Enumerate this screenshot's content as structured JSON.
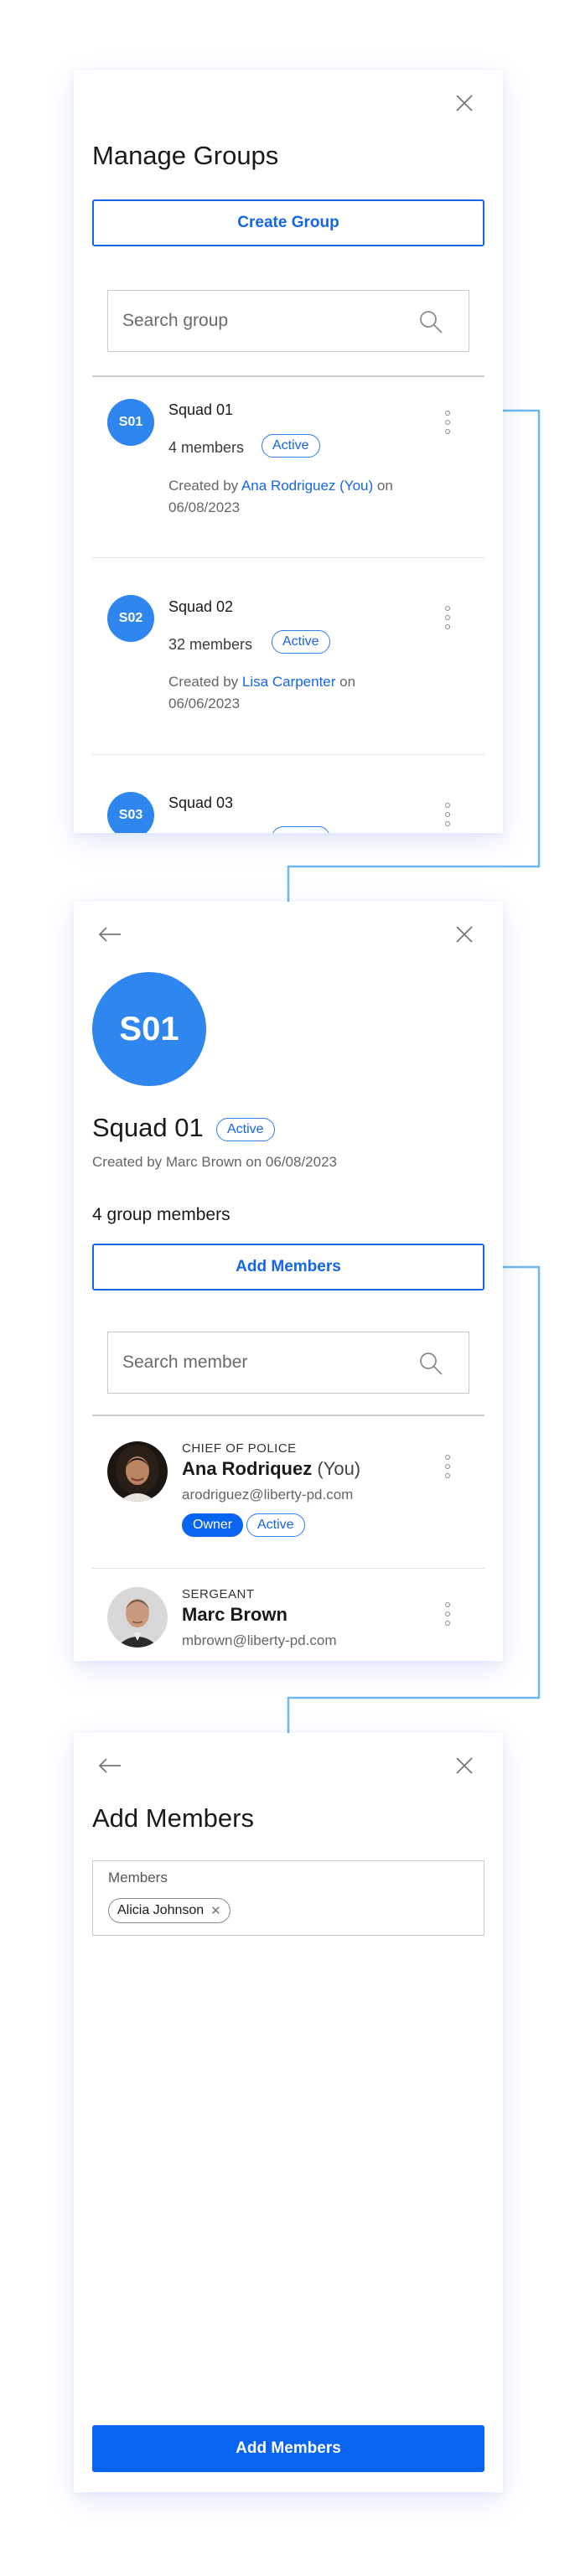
{
  "manage_groups": {
    "title": "Manage Groups",
    "create_button": "Create Group",
    "search_placeholder": "Search group",
    "groups": [
      {
        "initials": "S01",
        "name": "Squad 01",
        "members": "4 members",
        "status": "Active",
        "created_prefix": "Created by",
        "created_by": "Ana Rodriguez (You)",
        "created_on": "on 06/08/2023"
      },
      {
        "initials": "S02",
        "name": "Squad 02",
        "members": "32 members",
        "status": "Active",
        "created_prefix": "Created by",
        "created_by": "Lisa Carpenter",
        "created_on": "on 06/06/2023"
      },
      {
        "initials": "S03",
        "name": "Squad 03"
      }
    ]
  },
  "group_detail": {
    "initials": "S01",
    "name": "Squad 01",
    "status": "Active",
    "created": "Created by Marc Brown on 06/08/2023",
    "member_count": "4 group members",
    "add_button": "Add Members",
    "search_placeholder": "Search member",
    "members": [
      {
        "role": "CHIEF OF POLICE",
        "name": "Ana Rodriquez",
        "you": "(You)",
        "email": "arodriguez@liberty-pd.com",
        "badges": [
          "Owner",
          "Active"
        ]
      },
      {
        "role": "SERGEANT",
        "name": "Marc Brown",
        "email": "mbrown@liberty-pd.com"
      }
    ]
  },
  "add_members": {
    "title": "Add Members",
    "field_label": "Members",
    "selected": [
      "Alicia Johnson"
    ],
    "submit_button": "Add Members"
  },
  "colors": {
    "primary": "#0a64f2",
    "avatar": "#2f86ee",
    "connector": "#6fb8ec"
  },
  "icons": [
    "close-icon",
    "back-arrow-icon",
    "search-icon",
    "more-vertical-icon",
    "remove-chip-icon"
  ]
}
